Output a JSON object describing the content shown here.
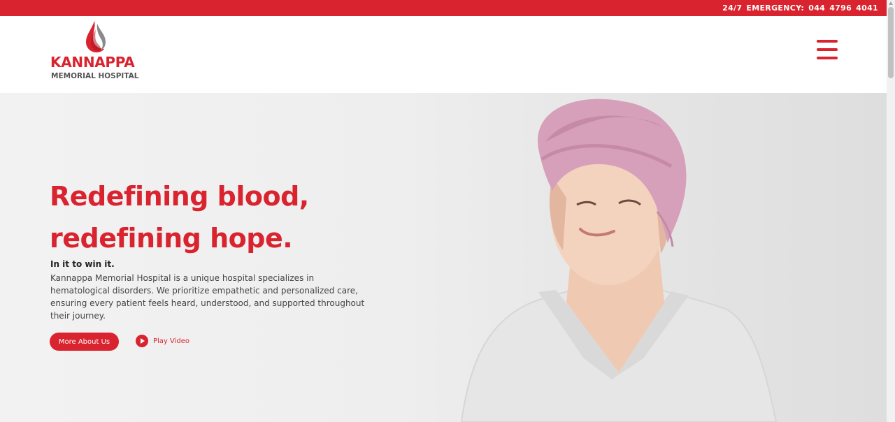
{
  "topbar": {
    "emergency": "24/7  EMERGENCY:  044  4796  4041"
  },
  "logo": {
    "name": "KANNAPPA",
    "subtitle": "MEMORIAL HOSPITAL"
  },
  "header": {
    "menu_icon": "hamburger-menu-icon"
  },
  "hero": {
    "title_line1": "Redefining blood,",
    "title_line2": "redefining hope.",
    "tagline": "In it to win it.",
    "description": "Kannappa Memorial Hospital is a unique hospital specializes in hematological disorders. We prioritize empathetic and personalized care, ensuring every patient feels heard, understood, and supported throughout their journey.",
    "more_button": "More About Us",
    "play_label": "Play Video",
    "play_icon": "play-circle-icon"
  },
  "colors": {
    "brand_red": "#d9232e",
    "text_dark": "#222222",
    "text_body": "#444444"
  }
}
